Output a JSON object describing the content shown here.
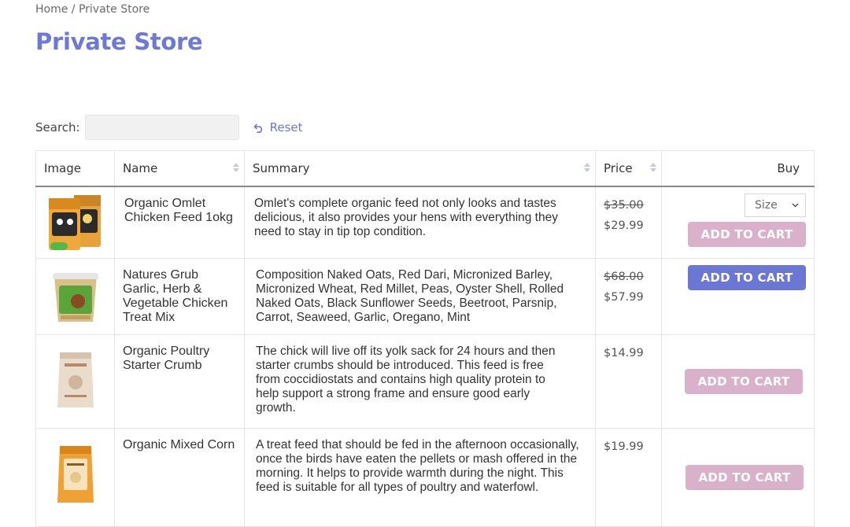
{
  "breadcrumb": {
    "home": "Home",
    "separator": "/",
    "current": "Private Store"
  },
  "page": {
    "title": "Private Store"
  },
  "search": {
    "label": "Search:",
    "value": "",
    "placeholder": ""
  },
  "reset": {
    "label": "Reset",
    "icon": "undo-icon"
  },
  "table": {
    "headers": {
      "image": "Image",
      "name": "Name",
      "summary": "Summary",
      "price": "Price",
      "buy": "Buy"
    },
    "rows": [
      {
        "name": "Organic Omlet Chicken Feed 1okg",
        "summary": "Omlet's complete organic feed not only looks and tastes delicious, it also provides your hens with everything they need to stay in tip top condition.",
        "old_price": "$35.00",
        "price": "$29.99",
        "size_label": "Size",
        "button": "ADD TO CART",
        "button_state": "disabled"
      },
      {
        "name": "Natures Grub Garlic, Herb & Vegetable Chicken Treat Mix",
        "summary": "Composition Naked Oats, Red Dari, Micronized Barley, Micronized Wheat, Red Millet, Peas, Oyster Shell, Rolled Naked Oats, Black Sunflower Seeds, Beetroot, Parsnip, Carrot, Seaweed, Garlic, Oregano, Mint",
        "old_price": "$68.00",
        "price": "$57.99",
        "button": "ADD TO CART",
        "button_state": "active"
      },
      {
        "name": "Organic Poultry Starter Crumb",
        "summary": "The chick will live off its yolk sack for 24 hours and then starter crumbs should be introduced. This feed is free from coccidiostats and contains high quality protein to help support a strong frame and ensure good early growth.",
        "price": "$14.99",
        "button": "ADD TO CART",
        "button_state": "disabled"
      },
      {
        "name": "Organic Mixed Corn",
        "summary": "A treat feed that should be fed in the afternoon occasionally, once the birds have eaten the pellets or mash offered in the morning. It helps to provide warmth during the night. This feed is suitable for all types of poultry and waterfowl.",
        "price": "$19.99",
        "button": "ADD TO CART",
        "button_state": "disabled"
      }
    ]
  },
  "colors": {
    "accent": "#6d79d6",
    "button_active": "#6b77d4",
    "button_disabled": "#d9b1ca"
  }
}
